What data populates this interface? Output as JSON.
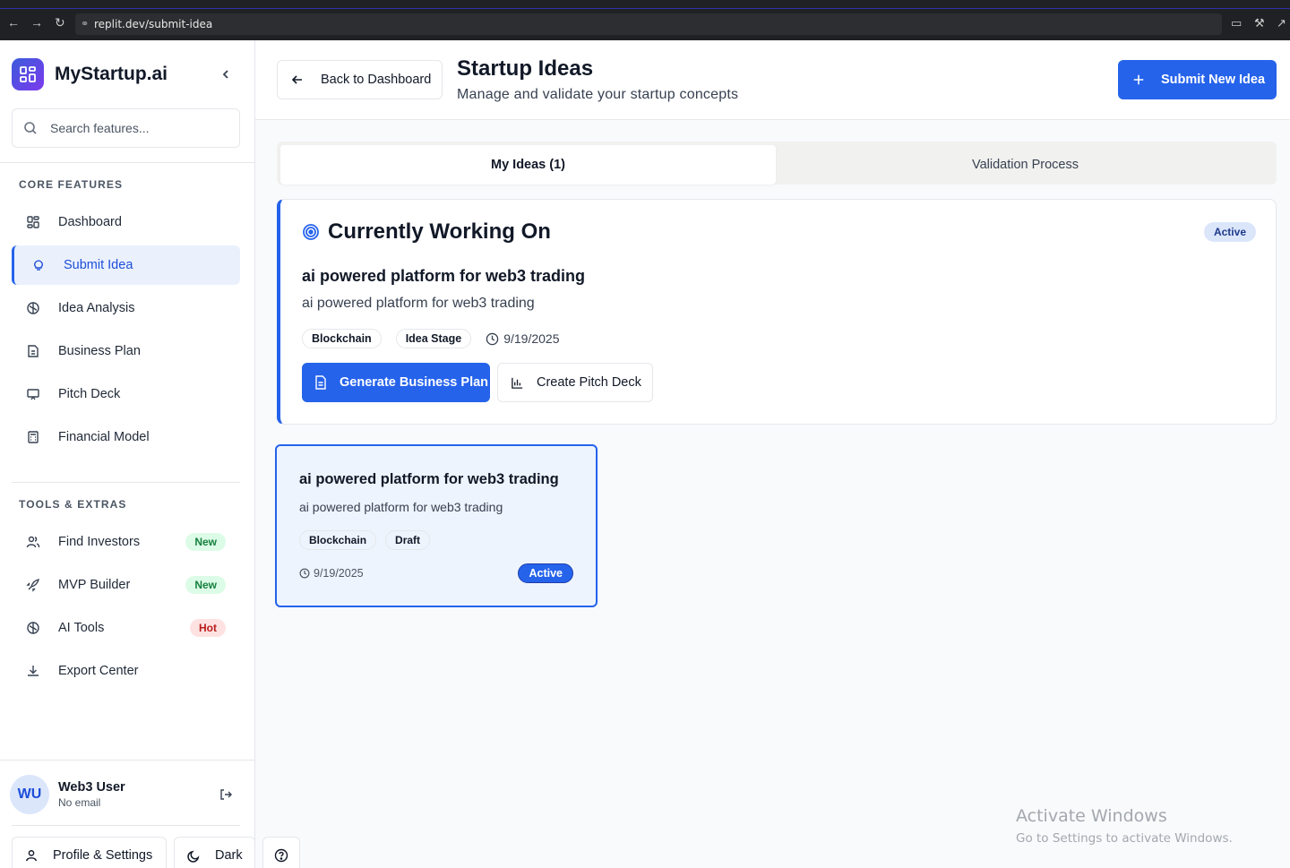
{
  "browser": {
    "url": "replit.dev/submit-idea"
  },
  "sidebar": {
    "brand": "MyStartup.ai",
    "search_placeholder": "Search features...",
    "core_title": "CORE FEATURES",
    "core_items": [
      {
        "label": "Dashboard",
        "icon": "grid-icon"
      },
      {
        "label": "Submit Idea",
        "icon": "lightbulb-icon",
        "active": true
      },
      {
        "label": "Idea Analysis",
        "icon": "brain-icon"
      },
      {
        "label": "Business Plan",
        "icon": "document-icon"
      },
      {
        "label": "Pitch Deck",
        "icon": "presentation-icon"
      },
      {
        "label": "Financial Model",
        "icon": "calculator-icon"
      }
    ],
    "tools_title": "TOOLS & EXTRAS",
    "tools_items": [
      {
        "label": "Find Investors",
        "icon": "users-icon",
        "badge": "New"
      },
      {
        "label": "MVP Builder",
        "icon": "rocket-icon",
        "badge": "New"
      },
      {
        "label": "AI Tools",
        "icon": "brain-icon",
        "badge": "Hot"
      },
      {
        "label": "Export Center",
        "icon": "download-icon"
      }
    ],
    "user": {
      "initials": "WU",
      "name": "Web3 User",
      "email": "No email"
    },
    "profile_label": "Profile & Settings",
    "theme_label": "Dark"
  },
  "header": {
    "back_label": "Back to Dashboard",
    "title": "Startup Ideas",
    "subtitle": "Manage and validate your startup concepts",
    "submit_label": "Submit New Idea"
  },
  "tabs": [
    {
      "label": "My Ideas (1)",
      "active": true
    },
    {
      "label": "Validation Process",
      "active": false
    }
  ],
  "current": {
    "heading": "Currently Working On",
    "status": "Active",
    "name": "ai powered platform for web3 trading",
    "description": "ai powered platform for web3 trading",
    "tags": [
      "Blockchain",
      "Idea Stage"
    ],
    "date": "9/19/2025",
    "generate_label": "Generate Business Plan",
    "pitch_label": "Create Pitch Deck"
  },
  "ideas": [
    {
      "name": "ai powered platform for web3 trading",
      "description": "ai powered platform for web3 trading",
      "tags": [
        "Blockchain",
        "Draft"
      ],
      "date": "9/19/2025",
      "status": "Active"
    }
  ],
  "watermark": {
    "line1": "Activate Windows",
    "line2": "Go to Settings to activate Windows."
  },
  "colors": {
    "accent": "#2563eb",
    "accent_soft": "#eaf1fd",
    "new_badge": "#dcfce7",
    "hot_badge": "#fee2e2"
  }
}
